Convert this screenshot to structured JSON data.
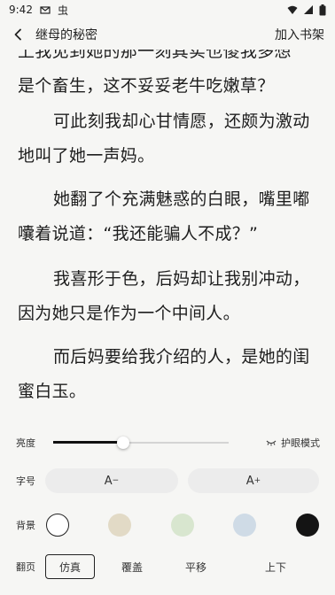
{
  "status_bar": {
    "time": "9:42",
    "app_glyph": "虫"
  },
  "header": {
    "title": "继母的秘密",
    "add_label": "加入书架"
  },
  "content": {
    "paragraphs": [
      {
        "lines": [
          "上我见到她的那一刻其实也傻我多想",
          "是个畜生，这不妥妥老牛吃嫩草？"
        ]
      },
      {
        "lines": [
          "可此刻我却心甘情愿，还颇为激动",
          "地叫了她一声妈。"
        ]
      },
      {
        "lines": [
          "她翻了个充满魅惑的白眼，嘴里嘟",
          "囔着说道：“我还能骗人不成？”"
        ]
      },
      {
        "lines": [
          "我喜形于色，后妈却让我别冲动，",
          "因为她只是作为一个中间人。"
        ]
      },
      {
        "lines": [
          "而后妈要给我介绍的人，是她的闺",
          "蜜白玉。"
        ]
      }
    ]
  },
  "settings": {
    "brightness": {
      "label": "亮度",
      "level": 0.4,
      "eye_label": "护眼模式"
    },
    "font_size": {
      "label": "字号",
      "decrease_label": "A",
      "increase_label": "A"
    },
    "background": {
      "label": "背景",
      "colors": [
        "#ffffff",
        "#e2dac6",
        "#d8e6cf",
        "#cfdbe6",
        "#141414"
      ],
      "selected": 0
    },
    "page_turn": {
      "label": "翻页",
      "options": [
        "仿真",
        "覆盖",
        "平移",
        "上下"
      ],
      "selected": 0
    }
  }
}
